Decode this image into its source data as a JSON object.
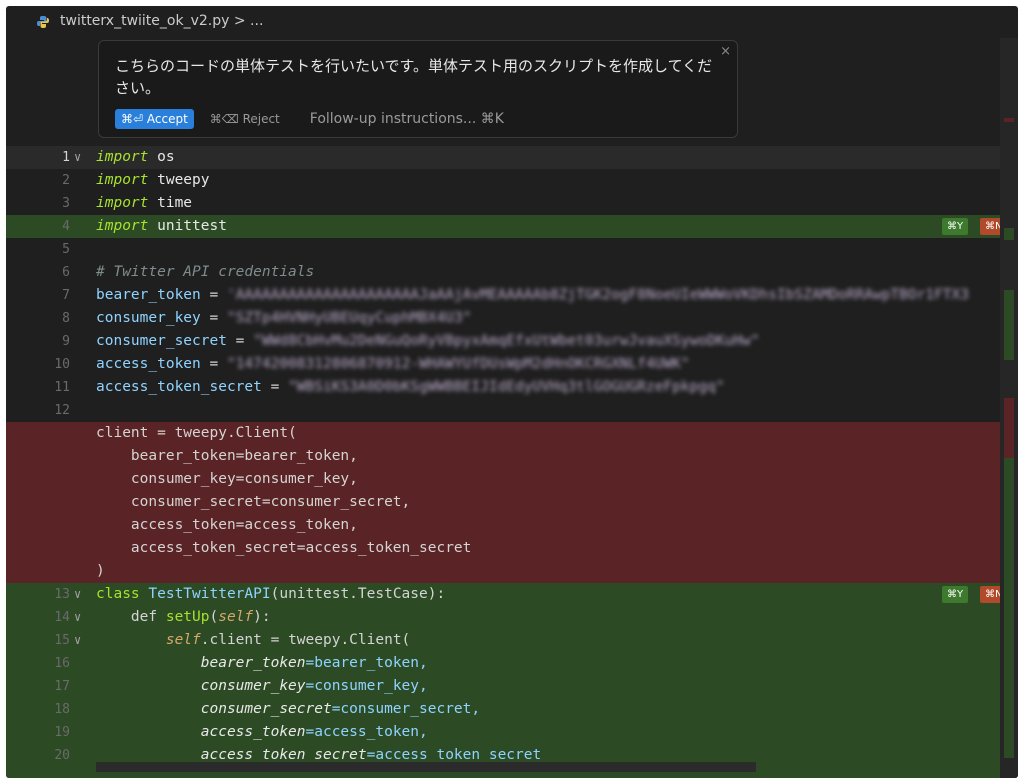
{
  "tab": {
    "filename": "twitterx_twiite_ok_v2.py",
    "breadcrumb_suffix": " > ...",
    "icon": "python-file-icon"
  },
  "prompt": {
    "text": "こちらのコードの単体テストを行いたいです。単体テスト用のスクリプトを作成してください。",
    "accept_label": "⌘⏎ Accept",
    "reject_label": "⌘⌫ Reject",
    "followup_label": "Follow-up instructions... ⌘K",
    "close_label": "×"
  },
  "hunk_pills": {
    "accept": "⌘Y",
    "reject": "⌘N"
  },
  "code": {
    "l1_kw": "import",
    "l1_mod": " os",
    "l2_kw": "import",
    "l2_mod": " tweepy",
    "l3_kw": "import",
    "l3_mod": " time",
    "l4_kw": "import",
    "l4_mod": " unittest",
    "l6": "# Twitter API credentials",
    "l7_var": "bearer_token",
    "l7_eq": " = ",
    "l7_str": "'AAAAAAAAAAAAAAAAAAAAAJaAAjAvMEAAAAAb8ZjTGK2ogF8NoeUIeWWWoVKDhsIbSZAMDoRRAwpTBOr1FTX3",
    "l8_var": "consumer_key",
    "l8_eq": " = ",
    "l8_str": "\"SZTp4HVNHyUBEUqyCuphMBX4U3\"",
    "l9_var": "consumer_secret",
    "l9_eq": " = ",
    "l9_str": "\"WWd8CbHvMu2DeNGuQoRyVBpyxAmqEfxUtWbet03urwJvauXSywoDKuHw\"",
    "l10_var": "access_token",
    "l10_eq": " = ",
    "l10_str": "\"14742008312806870912-WHAWYUfDUsWpM2dHnOKCRGXNLf4UWK\"",
    "l11_var": "access_token_secret",
    "l11_eq": " = ",
    "l11_str": "\"WBSiKS3A0D0bKSgWWBBEIJIdEdyUVHq3tlGOGUGRzeFpkpgq\"",
    "r1": "client = tweepy.Client(",
    "r2": "    bearer_token=bearer_token,",
    "r3": "    consumer_key=consumer_key,",
    "r4": "    consumer_secret=consumer_secret,",
    "r5": "    access_token=access_token,",
    "r6": "    access_token_secret=access_token_secret",
    "r7": ")",
    "l13_kw": "class",
    "l13_name": " TestTwitterAPI",
    "l13_rest": "(unittest.TestCase):",
    "l14_pre": "    def ",
    "l14_fn": "setUp",
    "l14_open": "(",
    "l14_self": "self",
    "l14_close": "):",
    "l15_pre": "        ",
    "l15_self": "self",
    "l15_rest": ".client = tweepy.Client(",
    "l16_param": "            bearer_token",
    "l16_rest": "=bearer_token,",
    "l17_param": "            consumer_key",
    "l17_rest": "=consumer_key,",
    "l18_param": "            consumer_secret",
    "l18_rest": "=consumer_secret,",
    "l19_param": "            access_token",
    "l19_rest": "=access_token,",
    "l20_param": "            access_token_secret",
    "l20_rest": "=access_token_secret"
  },
  "line_numbers": [
    "1",
    "2",
    "3",
    "4",
    "5",
    "6",
    "7",
    "8",
    "9",
    "10",
    "11",
    "12",
    "13",
    "14",
    "15",
    "16",
    "17",
    "18",
    "19",
    "20"
  ],
  "colors": {
    "added": "#2c4a24",
    "removed": "#5a2325",
    "accent": "#2a7fdb",
    "editor_bg": "#1f1f1f"
  }
}
